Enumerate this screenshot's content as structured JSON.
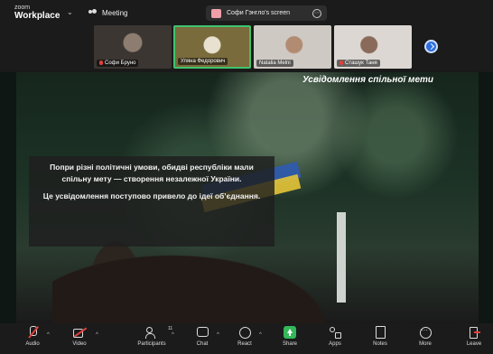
{
  "topbar": {
    "brand_small": "zoom",
    "brand_large": "Workplace",
    "meeting_label": "Meeting",
    "screen_share_label": "Софи Гэнгло's screen"
  },
  "gallery": {
    "participants": [
      {
        "name": "Софи Бруно",
        "muted": true
      },
      {
        "name": "Уляна Федорович",
        "muted": false
      },
      {
        "name": "Natalia Melni",
        "muted": false
      },
      {
        "name": "Сташук Таня",
        "muted": true
      }
    ]
  },
  "slide": {
    "title": "Усвідомлення спільної мети",
    "paragraph_1": "Попри різні політичні умови, обидві республіки мали спільну мету — створення незалежної України.",
    "paragraph_2": "Це усвідомлення поступово привело до ідеї об’єднання."
  },
  "toolbar": {
    "audio": "Audio",
    "video": "Video",
    "participants": "Participants",
    "participants_count": "11",
    "chat": "Chat",
    "react": "React",
    "share": "Share",
    "apps": "Apps",
    "notes": "Notes",
    "more": "More",
    "leave": "Leave"
  },
  "colors": {
    "active_speaker_border": "#3ec46d",
    "share_button": "#33b85a",
    "muted_red": "#e0413c",
    "next_button": "#2f6ee0"
  }
}
